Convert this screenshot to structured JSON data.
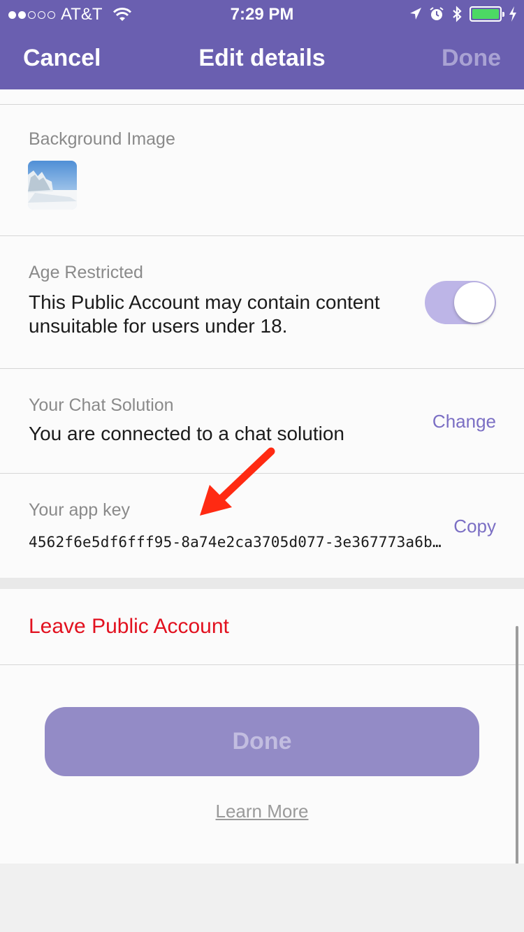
{
  "status_bar": {
    "signal_dots_full": 2,
    "signal_dots_total": 5,
    "carrier": "AT&T",
    "time": "7:29 PM",
    "battery_color": "#4cd964"
  },
  "nav": {
    "cancel_label": "Cancel",
    "title": "Edit details",
    "done_label": "Done"
  },
  "background_image": {
    "label": "Background Image",
    "thumbnail_icon": "winter-landscape-thumbnail"
  },
  "age_restricted": {
    "label": "Age Restricted",
    "description": "This Public Account may contain content unsuitable for users under 18.",
    "toggle_on": true
  },
  "chat_solution": {
    "label": "Your Chat Solution",
    "status": "You are connected to a chat solution",
    "action_label": "Change"
  },
  "app_key": {
    "label": "Your app key",
    "value": "4562f6e5df6fff95-8a74e2ca3705d077-3e367773a6b…",
    "action_label": "Copy"
  },
  "leave_label": "Leave Public Account",
  "primary_button_label": "Done",
  "learn_more_label": "Learn More",
  "colors": {
    "brand": "#6a5fb0",
    "accent": "#7b6fc4",
    "danger": "#e2111f"
  }
}
